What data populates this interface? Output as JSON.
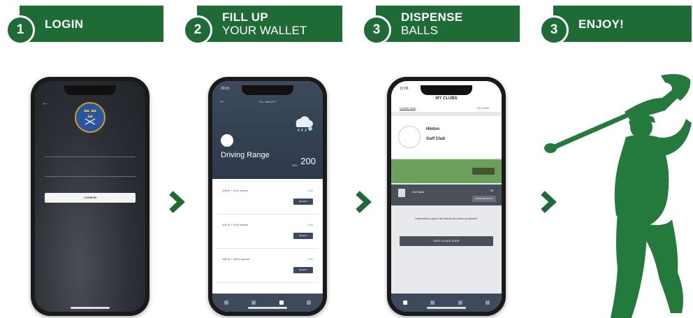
{
  "steps": [
    {
      "number": "1",
      "line1": "LOGIN",
      "line2": ""
    },
    {
      "number": "2",
      "line1": "FILL UP",
      "line2": "YOUR WALLET"
    },
    {
      "number": "3",
      "line1": "DISPENSE",
      "line2": "BALLS"
    },
    {
      "number": "3",
      "line1": "ENJOY!",
      "line2": ""
    }
  ],
  "login_screen": {
    "button_label": "LOGIN IN"
  },
  "wallet_screen": {
    "header_title": "FILL WALLET",
    "range_title": "Driving Range",
    "balance": "200",
    "balance_prefix": "SEK",
    "packages": [
      {
        "label": "100 kr + 10 kr bonus",
        "price": "- 100"
      },
      {
        "label": "100 kr + 75 kr bonus",
        "price": "- 150"
      },
      {
        "label": "150 kr + 150 kr bonus",
        "price": "- 150"
      }
    ],
    "package_button": "SELECT"
  },
  "clubs_screen": {
    "title": "MY CLUBS",
    "tabs": [
      "Current Club",
      "My Clubs"
    ],
    "club_name_1": "Hinton",
    "club_name_2": "Golf Club",
    "balls_label": "Golf Balls",
    "balls_count": "25",
    "dispense_button": "DISPENSE BALLS",
    "prompt": "Interested in green fee tickets and other products?",
    "shop_button": "VISIT CLUB'S SHOP"
  },
  "colors": {
    "brand_green": "#1e6b36",
    "chevron_green": "#1d6a35",
    "silhouette_green": "#237a3c"
  }
}
